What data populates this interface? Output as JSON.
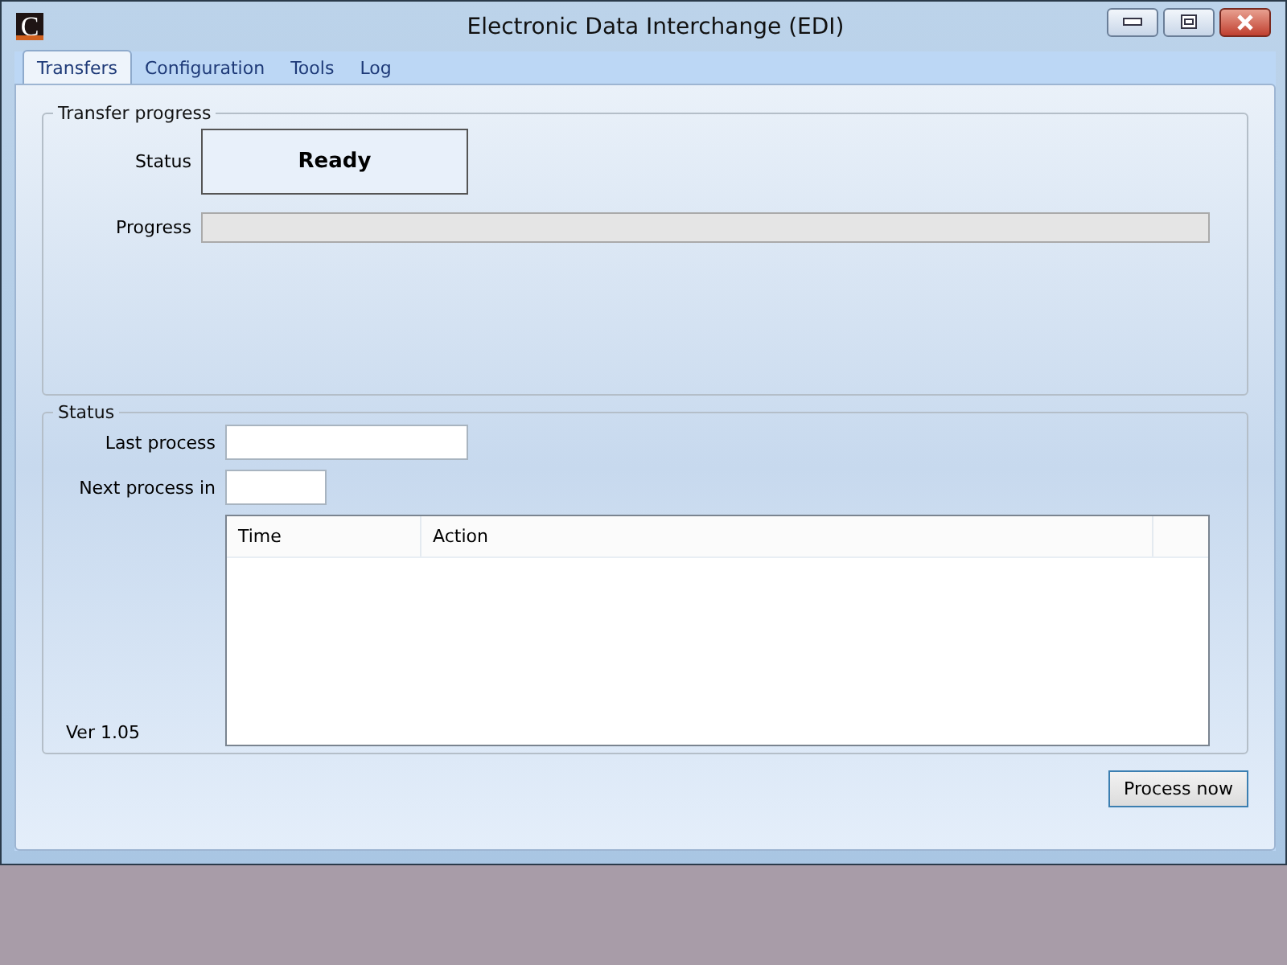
{
  "window": {
    "logo": "C",
    "title": "Electronic Data Interchange (EDI)"
  },
  "tabs": [
    {
      "label": "Transfers",
      "selected": true
    },
    {
      "label": "Configuration",
      "selected": false
    },
    {
      "label": "Tools",
      "selected": false
    },
    {
      "label": "Log",
      "selected": false
    }
  ],
  "transfer_progress": {
    "title": "Transfer progress",
    "status_label": "Status",
    "status_value": "Ready",
    "progress_label": "Progress",
    "level": 0
  },
  "status": {
    "title": "Status",
    "last_process_label": "Last process",
    "next_process_label": "Next process in",
    "version": "Ver 1.05",
    "table": {
      "columns": [
        "Time",
        "Action"
      ]
    }
  },
  "buttons": [
    "Process now"
  ]
}
